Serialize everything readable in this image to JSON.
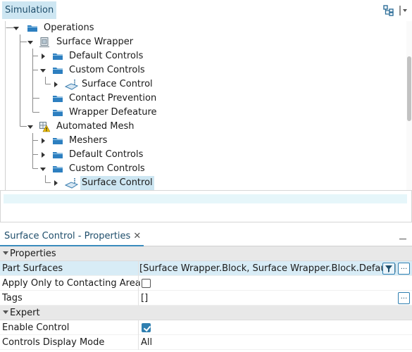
{
  "simulation_panel": {
    "tab_label": "Simulation",
    "tree": [
      {
        "label": "Operations",
        "icon": "folder-icon",
        "expanded": true
      },
      {
        "label": "Surface Wrapper",
        "icon": "surface-wrapper-icon",
        "expanded": true
      },
      {
        "label": "Default Controls",
        "icon": "folder-icon",
        "expanded": false
      },
      {
        "label": "Custom Controls",
        "icon": "folder-icon",
        "expanded": true
      },
      {
        "label": "Surface Control",
        "icon": "surface-control-icon",
        "expanded": false
      },
      {
        "label": "Contact Prevention",
        "icon": "folder-icon"
      },
      {
        "label": "Wrapper Defeature",
        "icon": "folder-icon"
      },
      {
        "label": "Automated Mesh",
        "icon": "automated-mesh-warning-icon",
        "expanded": true
      },
      {
        "label": "Meshers",
        "icon": "folder-icon",
        "expanded": false
      },
      {
        "label": "Default Controls",
        "icon": "folder-icon",
        "expanded": false
      },
      {
        "label": "Custom Controls",
        "icon": "folder-icon",
        "expanded": true
      },
      {
        "label": "Surface Control",
        "icon": "surface-control-icon",
        "expanded": false,
        "selected": true
      }
    ]
  },
  "properties_panel": {
    "tab_label": "Surface Control - Properties",
    "close_glyph": "✕",
    "sections": [
      {
        "label": "Properties"
      },
      {
        "label": "Expert"
      }
    ],
    "rows": {
      "part_surfaces": {
        "key": "Part Surfaces",
        "value": "[Surface Wrapper.Block, Surface Wrapper.Block.Default]"
      },
      "apply_only": {
        "key": "Apply Only to Contacting Area",
        "checked": false
      },
      "tags": {
        "key": "Tags",
        "value": "[]"
      },
      "enable_control": {
        "key": "Enable Control",
        "checked": true
      },
      "controls_display_mode": {
        "key": "Controls Display Mode",
        "value": "All"
      }
    },
    "ellipsis_label": "..."
  },
  "colors": {
    "selection": "#cde6f2",
    "accent": "#2f7fb0",
    "folder": "#2d7fc0",
    "warning": "#f2c200"
  }
}
